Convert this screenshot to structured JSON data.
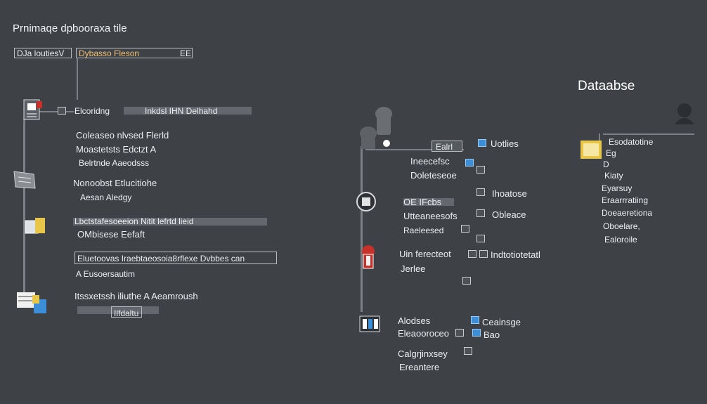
{
  "header": {
    "title": "Prnimaqe dpbooraxa tile",
    "tab_label": "DJa loutiesV",
    "field_label": "Dybasso Fleson",
    "field_tag": "EE"
  },
  "database_heading": "Dataabse",
  "left_column": {
    "node1_label": "Elcoridng",
    "node1_secondary": "Inkdsl IHN Delhahd",
    "group1": [
      "Coleaseo nlvsed Flerld",
      "Moastetsts  Edctzt A",
      "Belrtnde Aaeodsss"
    ],
    "group2": [
      "Nonoobst Etlucitiohe",
      "Aesan Aledgy"
    ],
    "group3": [
      "Lbctstafesoeeion Nitit  lefrtd lieid",
      "OMbisese Eefaft"
    ],
    "group4": [
      "Eluetoovas Iraebtaeosoia8rflexe Dvbbes can",
      "A Eusoersautim"
    ],
    "group5": [
      "Itssxetssh iliuthe A Aeamroush",
      "Ilfdaltu"
    ]
  },
  "middle_column": {
    "top_tag": "Ealrl",
    "top_label": "Uotlies",
    "node2_labels": [
      "Ineecefsc",
      "Doleteseoe"
    ],
    "node3_labels": [
      "OE  IFcbs",
      "Utteaneesofs",
      "Raeleesed"
    ],
    "node3_right": [
      "Ihoatose",
      "Obleace"
    ],
    "node4_labels": [
      "Uin ferecteot",
      "Jerlee"
    ],
    "node4_right": "Indtotiotetatl",
    "node5_labels": [
      "Alodses",
      "Eleaooroceo"
    ],
    "node5_right": [
      "Ceainsge",
      "Bao"
    ],
    "node6_labels": [
      "Calgrjinxsey",
      "Ereantere"
    ]
  },
  "right_column": {
    "list_header": "Esodatotine",
    "items": [
      "Eg",
      "D",
      "Kiaty",
      "Eyarsuy",
      "Eraarrratiing",
      "Doeaeretiona",
      "Oboelare,",
      "Ealoroile"
    ]
  },
  "colors": {
    "background": "#3e4247",
    "line": "#7c8086",
    "accent_red": "#c8302a",
    "accent_yellow": "#e8c64a",
    "accent_blue": "#3d8ed8"
  }
}
